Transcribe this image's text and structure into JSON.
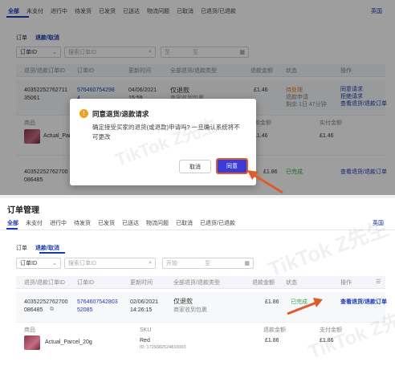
{
  "top": {
    "nav_tabs": [
      "全部",
      "未支付",
      "进行中",
      "待发货",
      "已发货",
      "已送达",
      "物流问题",
      "已取消",
      "已退货/已退款"
    ],
    "lang": "英国",
    "subtabs": [
      "订单",
      "退款/取消"
    ],
    "order_id_select": "订单ID",
    "search_placeholder": "搜索订单ID",
    "date_start": "至",
    "date_end": "至",
    "headers": [
      "退货/退款订单ID",
      "订单ID",
      "更新时间",
      "全部退货/退款类型",
      "退款金额",
      "状态",
      "操作"
    ],
    "row1": {
      "refund_id_a": "40352252762711",
      "refund_id_b": "35061",
      "order_id_a": "576460754298",
      "order_id_b": "4",
      "date": "04/06/2021",
      "time": "15:59",
      "type": "仅退款",
      "reason": "商家收到包裹",
      "amount": "£1.46",
      "status": "待处理",
      "status_sub": "退款申请",
      "status_timer": "剩余 1日 47分钟",
      "actions": [
        "同意请求",
        "拒绝请求",
        "查看退货/退款订单"
      ]
    },
    "product": {
      "label": "商品",
      "name": "Actual_Parc",
      "price_label": "退款金额",
      "price": "£1.46",
      "paid_label": "实付金额",
      "paid": "£1.46"
    },
    "row2": {
      "refund_id_a": "40352252762700",
      "refund_id_b": "086485",
      "amount": "£1.86",
      "status": "已完成",
      "action": "查看退货/退款订单"
    }
  },
  "modal": {
    "title": "同意退货/退款请求",
    "body": "确定接受买家的退货(或退款)申请吗? 一旦确认系统将不可更改",
    "cancel": "取消",
    "ok": "同意"
  },
  "bottom": {
    "title": "订单管理",
    "nav_tabs": [
      "全部",
      "未支付",
      "进行中",
      "待发货",
      "已发货",
      "已送达",
      "物流问题",
      "已取消",
      "已退货/已退款"
    ],
    "lang": "英国",
    "subtabs": [
      "订单",
      "退款/取消"
    ],
    "order_id_select": "订单ID",
    "search_placeholder": "搜索订单ID",
    "date_start": "开始",
    "date_end": "至",
    "headers": [
      "退货/退款订单ID",
      "订单ID",
      "更新时间",
      "全部退货/退款类型",
      "退款金额",
      "状态",
      "操作"
    ],
    "row": {
      "refund_id_a": "40352252762700",
      "refund_id_b": "086485",
      "order_id_a": "5764607542803",
      "order_id_b": "52085",
      "date": "02/06/2021",
      "time": "14:26:15",
      "type": "仅退款",
      "reason": "商家收到包裹",
      "amount": "£1.86",
      "status": "已完成",
      "action": "查看退货/退款订单"
    },
    "product": {
      "label": "商品",
      "name": "Actual_Parcel_20g",
      "sku_label": "SKU",
      "sku": "Red",
      "sku_id": "ID: 1729382524810003",
      "refund_label": "退款金额",
      "refund": "£1.86",
      "paid_label": "支付金额",
      "paid": "£1.86"
    }
  },
  "watermark": "TikTok Z先生",
  "colors": {
    "accent": "#1a3ab5",
    "success": "#2ea84a",
    "warning": "#e67e22",
    "arrow": "#e05a2b"
  }
}
